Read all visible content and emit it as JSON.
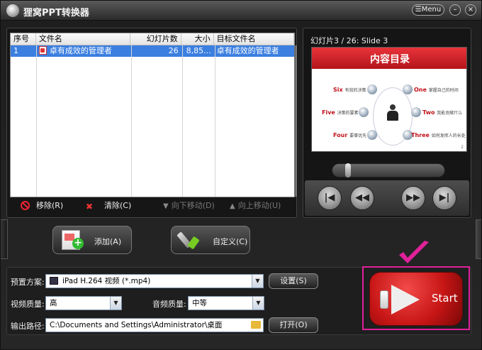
{
  "app": {
    "title": "狸窝PPT转换器",
    "menu_label": "Menu",
    "minimize": "–",
    "close": "×"
  },
  "file_list": {
    "columns": [
      "序号",
      "文件名",
      "幻灯片数",
      "大小",
      "目标文件名"
    ],
    "rows": [
      {
        "index": "1",
        "filename": "卓有成效的管理者",
        "slides": "26",
        "size": "8,85...",
        "target": "卓有成效的管理者"
      }
    ]
  },
  "actions": {
    "remove": "移除(R)",
    "clear": "清除(C)",
    "move_down": "向下移动(D)",
    "move_up": "向上移动(U)"
  },
  "buttons": {
    "add": "添加(A)",
    "customize": "自定义(C)"
  },
  "preview": {
    "slide_label": "幻灯片3 / 26: Slide 3",
    "slide": {
      "title": "内容目录",
      "items": [
        {
          "word": "Six",
          "sub": "有效的决策"
        },
        {
          "word": "One",
          "sub": "掌握自己的时间"
        },
        {
          "word": "Five",
          "sub": "决策的要素"
        },
        {
          "word": "Two",
          "sub": "我能贡献什么"
        },
        {
          "word": "Four",
          "sub": "要事优先"
        },
        {
          "word": "Three",
          "sub": "如何发挥人的长处"
        }
      ]
    },
    "position_fraction": 0.12
  },
  "settings": {
    "preset_label": "预置方案:",
    "preset_value": "iPad H.264 视频 (*.mp4)",
    "preset_button": "设置(S)",
    "video_quality_label": "视频质量:",
    "video_quality_value": "高",
    "audio_quality_label": "音频质量:",
    "audio_quality_value": "中等",
    "output_label": "输出路径:",
    "output_value": "C:\\Documents and Settings\\Administrator\\桌面",
    "open_button": "打开(O)"
  },
  "start": {
    "label": "Start"
  },
  "colors": {
    "selection": "#3b7fe0",
    "start": "#c81616",
    "highlight_frame": "#e0219a"
  }
}
